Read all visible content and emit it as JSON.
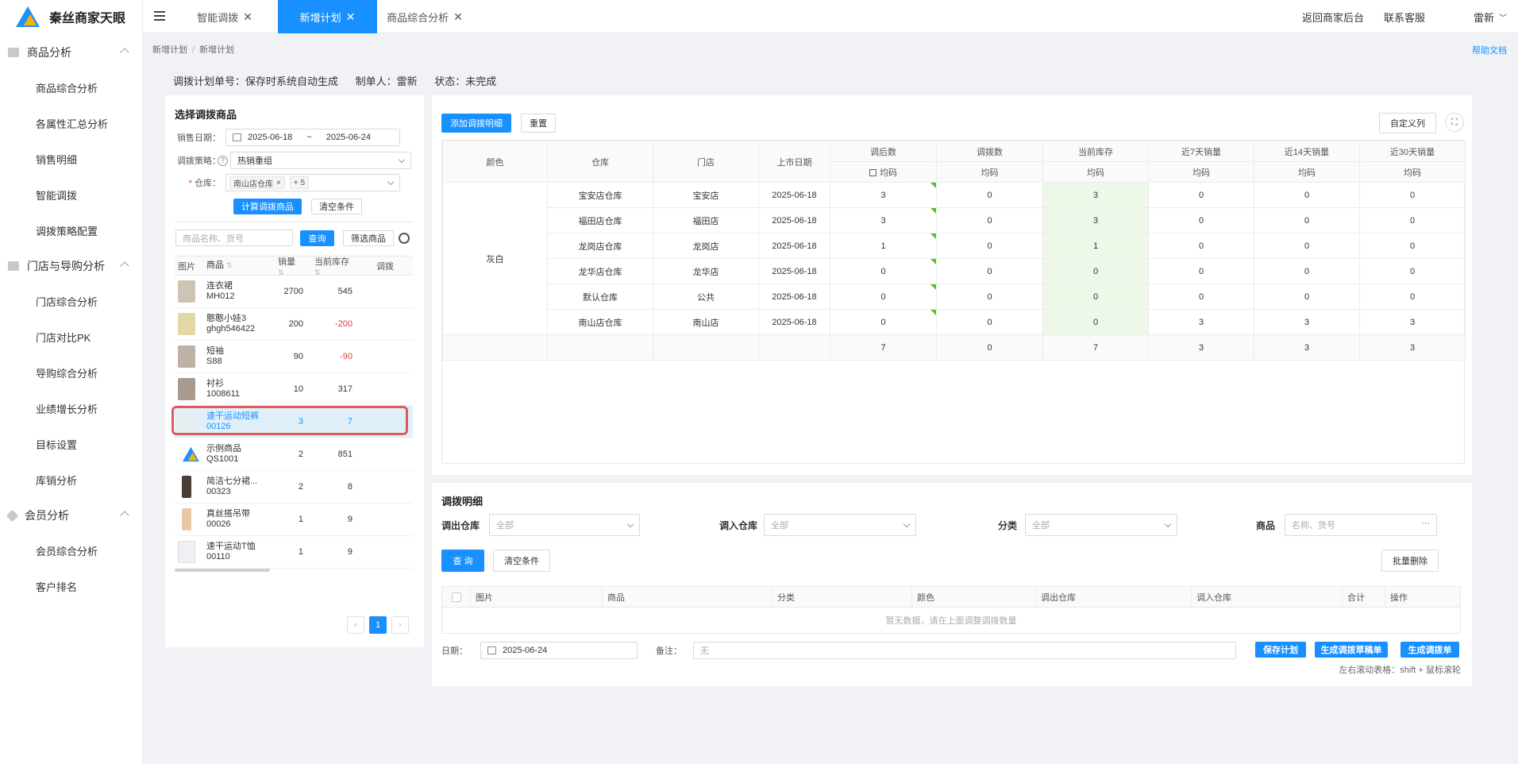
{
  "app": {
    "title": "秦丝商家天眼"
  },
  "sidebar": {
    "groups": [
      {
        "label": "商品分析",
        "items": [
          "商品综合分析",
          "各属性汇总分析",
          "销售明细",
          "智能调拨",
          "调拨策略配置"
        ]
      },
      {
        "label": "门店与导购分析",
        "items": [
          "门店综合分析",
          "门店对比PK",
          "导购综合分析",
          "业绩增长分析",
          "目标设置",
          "库销分析"
        ]
      },
      {
        "label": "会员分析",
        "items": [
          "会员综合分析",
          "客户排名"
        ]
      }
    ]
  },
  "tabs": [
    {
      "label": "智能调拨"
    },
    {
      "label": "新增计划"
    },
    {
      "label": "商品综合分析"
    }
  ],
  "header_right": {
    "back": "返回商家后台",
    "contact": "联系客服",
    "user": "雷新"
  },
  "breadcrumb": {
    "parent": "新增计划",
    "current": "新增计划"
  },
  "help": "帮助文档",
  "meta": {
    "plan_no": "调拨计划单号：保存时系统自动生成",
    "creator": "制单人：雷新",
    "status": "状态：未完成"
  },
  "left": {
    "title": "选择调拨商品",
    "sales_date_label": "销售日期：",
    "date_start": "2025-06-18",
    "date_sep": "~",
    "date_end": "2025-06-24",
    "strategy_label": "调拨策略：",
    "strategy_value": "热销重组",
    "warehouse_label": "仓库：",
    "warehouse_tag": "南山店仓库",
    "warehouse_more": "+ 5",
    "calc_button": "计算调拨商品",
    "clear_button": "清空条件",
    "search_placeholder": "商品名称、货号",
    "query_button": "查询",
    "filter_button": "筛选商品",
    "columns": [
      "图片",
      "商品",
      "销量",
      "当前库存",
      "调拨"
    ],
    "rows": [
      {
        "name": "连衣裙",
        "code": "MH012",
        "sales": "2700",
        "stock": "545"
      },
      {
        "name": "憨憨小娃3",
        "code": "ghgh546422",
        "sales": "200",
        "stock": "-200"
      },
      {
        "name": "短袖",
        "code": "S88",
        "sales": "90",
        "stock": "-90"
      },
      {
        "name": "衬衫",
        "code": "1008611",
        "sales": "10",
        "stock": "317"
      },
      {
        "name": "速干运动短裤",
        "code": "00126",
        "sales": "3",
        "stock": "7"
      },
      {
        "name": "示例商品",
        "code": "QS1001",
        "sales": "2",
        "stock": "851"
      },
      {
        "name": "简洁七分裙...",
        "code": "00323",
        "sales": "2",
        "stock": "8"
      },
      {
        "name": "真丝搭吊带",
        "code": "00026",
        "sales": "1",
        "stock": "9"
      },
      {
        "name": "速干运动T恤",
        "code": "00110",
        "sales": "1",
        "stock": "9"
      }
    ],
    "page": "1"
  },
  "matrix": {
    "add_button": "添加调拨明细",
    "reset_button": "重置",
    "custom_cols_button": "自定义列",
    "headers": [
      "颜色",
      "仓库",
      "门店",
      "上市日期",
      "调后数",
      "调拨数",
      "当前库存",
      "近7天销量",
      "近14天销量",
      "近30天销量"
    ],
    "size_label": "均码",
    "color": "灰白",
    "rows": [
      {
        "warehouse": "宝安店仓库",
        "store": "宝安店",
        "date": "2025-06-18",
        "after": "3",
        "adjust": "0",
        "stock": "3",
        "s7": "0",
        "s14": "0",
        "s30": "0"
      },
      {
        "warehouse": "福田店仓库",
        "store": "福田店",
        "date": "2025-06-18",
        "after": "3",
        "adjust": "0",
        "stock": "3",
        "s7": "0",
        "s14": "0",
        "s30": "0"
      },
      {
        "warehouse": "龙岗店仓库",
        "store": "龙岗店",
        "date": "2025-06-18",
        "after": "1",
        "adjust": "0",
        "stock": "1",
        "s7": "0",
        "s14": "0",
        "s30": "0"
      },
      {
        "warehouse": "龙华店仓库",
        "store": "龙华店",
        "date": "2025-06-18",
        "after": "0",
        "adjust": "0",
        "stock": "0",
        "s7": "0",
        "s14": "0",
        "s30": "0"
      },
      {
        "warehouse": "默认仓库",
        "store": "公共",
        "date": "2025-06-18",
        "after": "0",
        "adjust": "0",
        "stock": "0",
        "s7": "0",
        "s14": "0",
        "s30": "0"
      },
      {
        "warehouse": "南山店仓库",
        "store": "南山店",
        "date": "2025-06-18",
        "after": "0",
        "adjust": "0",
        "stock": "0",
        "s7": "3",
        "s14": "3",
        "s30": "3"
      }
    ],
    "totals": {
      "after": "7",
      "adjust": "0",
      "stock": "7",
      "s7": "3",
      "s14": "3",
      "s30": "3"
    }
  },
  "detail": {
    "title": "调拨明细",
    "out_label": "调出仓库",
    "in_label": "调入仓库",
    "category_label": "分类",
    "product_label": "商品",
    "all": "全部",
    "product_placeholder": "名称、货号",
    "query_button": "查 询",
    "clear_button": "清空条件",
    "batch_delete": "批量删除",
    "columns": [
      "图片",
      "商品",
      "分类",
      "颜色",
      "调出仓库",
      "调入仓库",
      "合计",
      "操作"
    ],
    "empty": "暂无数据，请在上面调整调拨数量",
    "date_label": "日期：",
    "date_value": "2025-06-24",
    "remark_label": "备注：",
    "remark_placeholder": "无",
    "save_button": "保存计划",
    "draft_button": "生成调拨草稿单",
    "create_button": "生成调拨单",
    "scroll_hint": "左右滚动表格：shift + 鼠标滚轮"
  }
}
